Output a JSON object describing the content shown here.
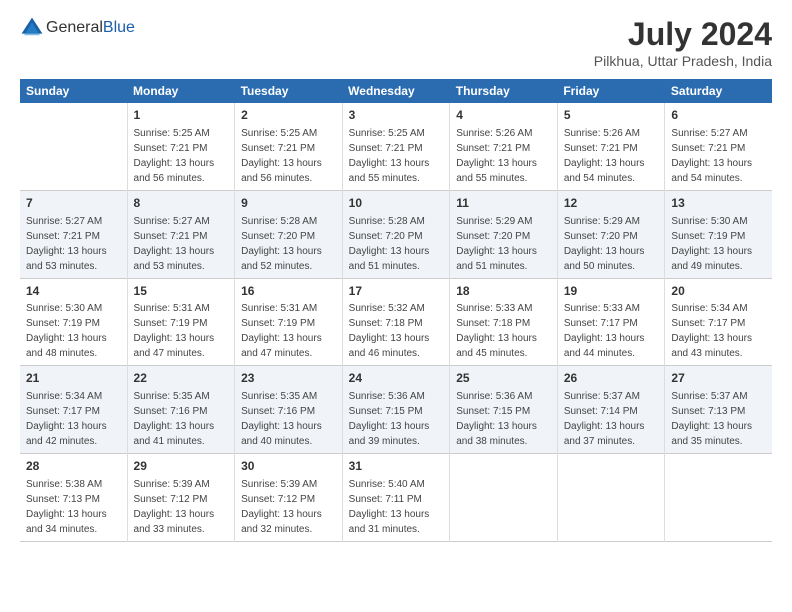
{
  "header": {
    "logo_general": "General",
    "logo_blue": "Blue",
    "month_year": "July 2024",
    "location": "Pilkhua, Uttar Pradesh, India"
  },
  "calendar": {
    "days_header": [
      "Sunday",
      "Monday",
      "Tuesday",
      "Wednesday",
      "Thursday",
      "Friday",
      "Saturday"
    ],
    "weeks": [
      {
        "group": 1,
        "cells": [
          {
            "day": "",
            "info": ""
          },
          {
            "day": "1",
            "info": "Sunrise: 5:25 AM\nSunset: 7:21 PM\nDaylight: 13 hours\nand 56 minutes."
          },
          {
            "day": "2",
            "info": "Sunrise: 5:25 AM\nSunset: 7:21 PM\nDaylight: 13 hours\nand 56 minutes."
          },
          {
            "day": "3",
            "info": "Sunrise: 5:25 AM\nSunset: 7:21 PM\nDaylight: 13 hours\nand 55 minutes."
          },
          {
            "day": "4",
            "info": "Sunrise: 5:26 AM\nSunset: 7:21 PM\nDaylight: 13 hours\nand 55 minutes."
          },
          {
            "day": "5",
            "info": "Sunrise: 5:26 AM\nSunset: 7:21 PM\nDaylight: 13 hours\nand 54 minutes."
          },
          {
            "day": "6",
            "info": "Sunrise: 5:27 AM\nSunset: 7:21 PM\nDaylight: 13 hours\nand 54 minutes."
          }
        ]
      },
      {
        "group": 2,
        "cells": [
          {
            "day": "7",
            "info": "Sunrise: 5:27 AM\nSunset: 7:21 PM\nDaylight: 13 hours\nand 53 minutes."
          },
          {
            "day": "8",
            "info": "Sunrise: 5:27 AM\nSunset: 7:21 PM\nDaylight: 13 hours\nand 53 minutes."
          },
          {
            "day": "9",
            "info": "Sunrise: 5:28 AM\nSunset: 7:20 PM\nDaylight: 13 hours\nand 52 minutes."
          },
          {
            "day": "10",
            "info": "Sunrise: 5:28 AM\nSunset: 7:20 PM\nDaylight: 13 hours\nand 51 minutes."
          },
          {
            "day": "11",
            "info": "Sunrise: 5:29 AM\nSunset: 7:20 PM\nDaylight: 13 hours\nand 51 minutes."
          },
          {
            "day": "12",
            "info": "Sunrise: 5:29 AM\nSunset: 7:20 PM\nDaylight: 13 hours\nand 50 minutes."
          },
          {
            "day": "13",
            "info": "Sunrise: 5:30 AM\nSunset: 7:19 PM\nDaylight: 13 hours\nand 49 minutes."
          }
        ]
      },
      {
        "group": 3,
        "cells": [
          {
            "day": "14",
            "info": "Sunrise: 5:30 AM\nSunset: 7:19 PM\nDaylight: 13 hours\nand 48 minutes."
          },
          {
            "day": "15",
            "info": "Sunrise: 5:31 AM\nSunset: 7:19 PM\nDaylight: 13 hours\nand 47 minutes."
          },
          {
            "day": "16",
            "info": "Sunrise: 5:31 AM\nSunset: 7:19 PM\nDaylight: 13 hours\nand 47 minutes."
          },
          {
            "day": "17",
            "info": "Sunrise: 5:32 AM\nSunset: 7:18 PM\nDaylight: 13 hours\nand 46 minutes."
          },
          {
            "day": "18",
            "info": "Sunrise: 5:33 AM\nSunset: 7:18 PM\nDaylight: 13 hours\nand 45 minutes."
          },
          {
            "day": "19",
            "info": "Sunrise: 5:33 AM\nSunset: 7:17 PM\nDaylight: 13 hours\nand 44 minutes."
          },
          {
            "day": "20",
            "info": "Sunrise: 5:34 AM\nSunset: 7:17 PM\nDaylight: 13 hours\nand 43 minutes."
          }
        ]
      },
      {
        "group": 4,
        "cells": [
          {
            "day": "21",
            "info": "Sunrise: 5:34 AM\nSunset: 7:17 PM\nDaylight: 13 hours\nand 42 minutes."
          },
          {
            "day": "22",
            "info": "Sunrise: 5:35 AM\nSunset: 7:16 PM\nDaylight: 13 hours\nand 41 minutes."
          },
          {
            "day": "23",
            "info": "Sunrise: 5:35 AM\nSunset: 7:16 PM\nDaylight: 13 hours\nand 40 minutes."
          },
          {
            "day": "24",
            "info": "Sunrise: 5:36 AM\nSunset: 7:15 PM\nDaylight: 13 hours\nand 39 minutes."
          },
          {
            "day": "25",
            "info": "Sunrise: 5:36 AM\nSunset: 7:15 PM\nDaylight: 13 hours\nand 38 minutes."
          },
          {
            "day": "26",
            "info": "Sunrise: 5:37 AM\nSunset: 7:14 PM\nDaylight: 13 hours\nand 37 minutes."
          },
          {
            "day": "27",
            "info": "Sunrise: 5:37 AM\nSunset: 7:13 PM\nDaylight: 13 hours\nand 35 minutes."
          }
        ]
      },
      {
        "group": 5,
        "cells": [
          {
            "day": "28",
            "info": "Sunrise: 5:38 AM\nSunset: 7:13 PM\nDaylight: 13 hours\nand 34 minutes."
          },
          {
            "day": "29",
            "info": "Sunrise: 5:39 AM\nSunset: 7:12 PM\nDaylight: 13 hours\nand 33 minutes."
          },
          {
            "day": "30",
            "info": "Sunrise: 5:39 AM\nSunset: 7:12 PM\nDaylight: 13 hours\nand 32 minutes."
          },
          {
            "day": "31",
            "info": "Sunrise: 5:40 AM\nSunset: 7:11 PM\nDaylight: 13 hours\nand 31 minutes."
          },
          {
            "day": "",
            "info": ""
          },
          {
            "day": "",
            "info": ""
          },
          {
            "day": "",
            "info": ""
          }
        ]
      }
    ]
  }
}
